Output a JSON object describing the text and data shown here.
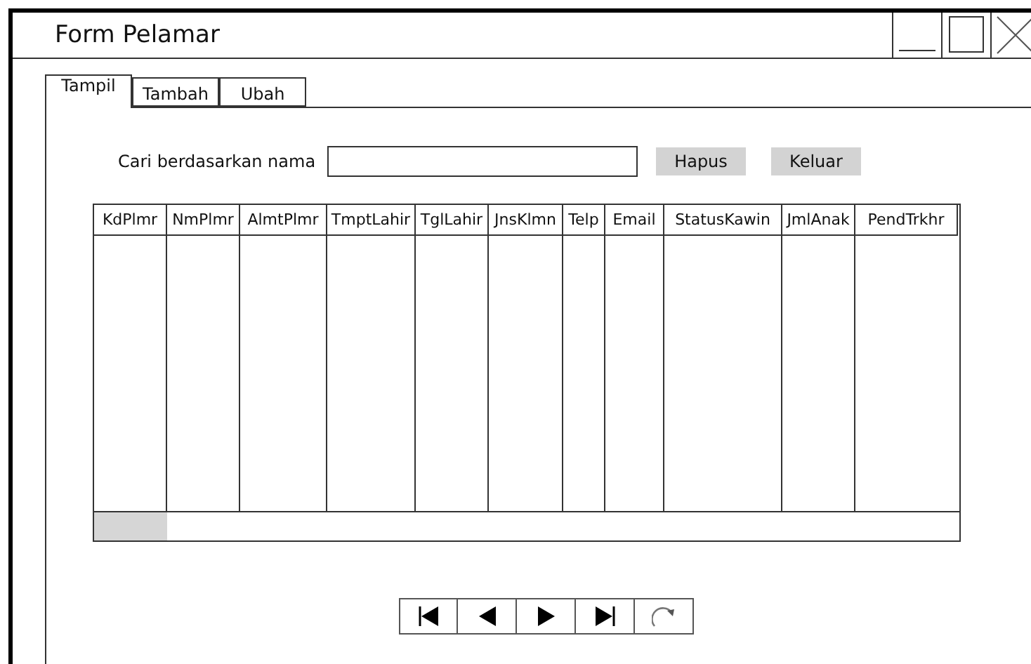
{
  "window": {
    "title": "Form Pelamar"
  },
  "tabs": [
    {
      "label": "Tampil",
      "selected": true
    },
    {
      "label": "Tambah",
      "selected": false
    },
    {
      "label": "Ubah",
      "selected": false
    }
  ],
  "search": {
    "label": "Cari berdasarkan nama"
  },
  "buttons": [
    "Hapus",
    "Keluar"
  ],
  "table": {
    "columns": [
      "KdPlmr",
      "NmPlmr",
      "AlmtPlmr",
      "TmptLahir",
      "TglLahir",
      "JnsKlmn",
      "Telp",
      "Email",
      "StatusKawin",
      "JmlAnak",
      "PendTrkhr"
    ]
  },
  "navigator": [
    {
      "kind": "first"
    },
    {
      "kind": "prev"
    },
    {
      "kind": "next"
    },
    {
      "kind": "last"
    },
    {
      "kind": "refresh"
    }
  ]
}
